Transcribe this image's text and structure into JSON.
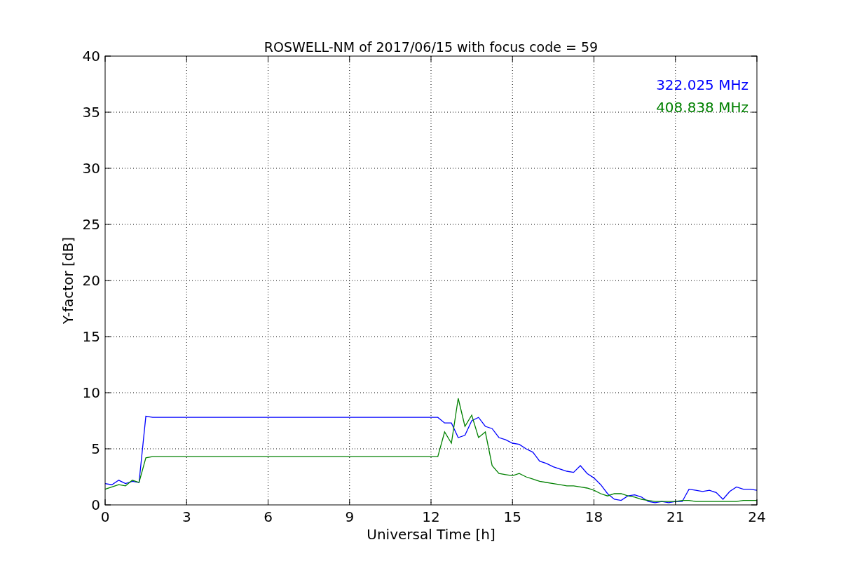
{
  "figure": {
    "chart_data": {
      "type": "line",
      "title": "ROSWELL-NM of 2017/06/15 with focus code = 59",
      "xlabel": "Universal Time [h]",
      "ylabel": "Y-factor [dB]",
      "grid": true,
      "xlim": [
        0,
        24
      ],
      "ylim": [
        0,
        40
      ],
      "xticks": [
        0,
        3,
        6,
        9,
        12,
        15,
        18,
        21,
        24
      ],
      "yticks": [
        0,
        5,
        10,
        15,
        20,
        25,
        30,
        35,
        40
      ],
      "x": [
        0,
        0.25,
        0.5,
        0.75,
        1,
        1.25,
        1.5,
        1.75,
        2,
        2.25,
        2.5,
        2.75,
        3,
        3.25,
        3.5,
        3.75,
        4,
        4.25,
        4.5,
        4.75,
        5,
        5.25,
        5.5,
        5.75,
        6,
        6.25,
        6.5,
        6.75,
        7,
        7.25,
        7.5,
        7.75,
        8,
        8.25,
        8.5,
        8.75,
        9,
        9.25,
        9.5,
        9.75,
        10,
        10.25,
        10.5,
        10.75,
        11,
        11.25,
        11.5,
        11.75,
        12,
        12.25,
        12.5,
        12.75,
        13,
        13.25,
        13.5,
        13.75,
        14,
        14.25,
        14.5,
        14.75,
        15,
        15.25,
        15.5,
        15.75,
        16,
        16.25,
        16.5,
        16.75,
        17,
        17.25,
        17.5,
        17.75,
        18,
        18.25,
        18.5,
        18.75,
        19,
        19.25,
        19.5,
        19.75,
        20,
        20.25,
        20.5,
        20.75,
        21,
        21.25,
        21.5,
        21.75,
        22,
        22.25,
        22.5,
        22.75,
        23,
        23.25,
        23.5,
        23.75,
        24
      ],
      "series": [
        {
          "name": "322.025 MHz",
          "color": "#0000ff",
          "values": [
            1.9,
            1.8,
            2.2,
            1.9,
            2.1,
            2.0,
            7.9,
            7.8,
            7.8,
            7.8,
            7.8,
            7.8,
            7.8,
            7.8,
            7.8,
            7.8,
            7.8,
            7.8,
            7.8,
            7.8,
            7.8,
            7.8,
            7.8,
            7.8,
            7.8,
            7.8,
            7.8,
            7.8,
            7.8,
            7.8,
            7.8,
            7.8,
            7.8,
            7.8,
            7.8,
            7.8,
            7.8,
            7.8,
            7.8,
            7.8,
            7.8,
            7.8,
            7.8,
            7.8,
            7.8,
            7.8,
            7.8,
            7.8,
            7.8,
            7.8,
            7.3,
            7.3,
            6.0,
            6.2,
            7.5,
            7.8,
            7.0,
            6.8,
            6.0,
            5.8,
            5.5,
            5.4,
            5.0,
            4.7,
            3.9,
            3.7,
            3.4,
            3.2,
            3.0,
            2.9,
            3.5,
            2.8,
            2.4,
            1.8,
            1.0,
            0.5,
            0.4,
            0.8,
            0.9,
            0.7,
            0.3,
            0.2,
            0.3,
            0.2,
            0.3,
            0.3,
            1.4,
            1.3,
            1.2,
            1.3,
            1.1,
            0.5,
            1.2,
            1.6,
            1.4,
            1.4,
            1.3
          ]
        },
        {
          "name": "408.838 MHz",
          "color": "#008000",
          "values": [
            1.4,
            1.6,
            1.8,
            1.7,
            2.2,
            2.0,
            4.2,
            4.3,
            4.3,
            4.3,
            4.3,
            4.3,
            4.3,
            4.3,
            4.3,
            4.3,
            4.3,
            4.3,
            4.3,
            4.3,
            4.3,
            4.3,
            4.3,
            4.3,
            4.3,
            4.3,
            4.3,
            4.3,
            4.3,
            4.3,
            4.3,
            4.3,
            4.3,
            4.3,
            4.3,
            4.3,
            4.3,
            4.3,
            4.3,
            4.3,
            4.3,
            4.3,
            4.3,
            4.3,
            4.3,
            4.3,
            4.3,
            4.3,
            4.3,
            4.3,
            6.5,
            5.5,
            9.5,
            7.0,
            8.0,
            6.0,
            6.5,
            3.5,
            2.8,
            2.7,
            2.6,
            2.8,
            2.5,
            2.3,
            2.1,
            2.0,
            1.9,
            1.8,
            1.7,
            1.7,
            1.6,
            1.5,
            1.3,
            1.0,
            0.8,
            1.0,
            1.0,
            0.8,
            0.7,
            0.5,
            0.4,
            0.3,
            0.3,
            0.3,
            0.3,
            0.4,
            0.4,
            0.3,
            0.3,
            0.3,
            0.3,
            0.3,
            0.3,
            0.3,
            0.4,
            0.4,
            0.4
          ]
        }
      ]
    }
  }
}
